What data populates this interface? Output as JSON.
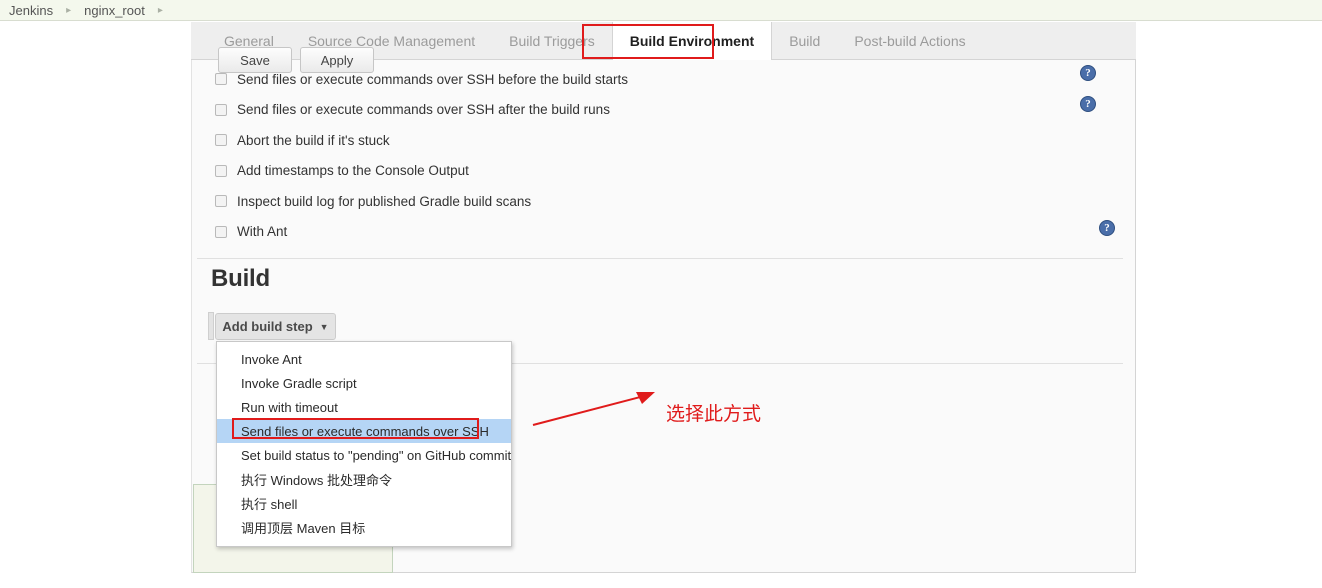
{
  "breadcrumb": {
    "items": [
      "Jenkins",
      "nginx_root"
    ],
    "separator": "▸"
  },
  "tabs": [
    {
      "label": "General",
      "selected": false
    },
    {
      "label": "Source Code Management",
      "selected": false
    },
    {
      "label": "Build Triggers",
      "selected": false
    },
    {
      "label": "Build Environment",
      "selected": true
    },
    {
      "label": "Build",
      "selected": false
    },
    {
      "label": "Post-build Actions",
      "selected": false
    }
  ],
  "build_environment": {
    "checkboxes": [
      {
        "label": "Send files or execute commands over SSH before the build starts",
        "checked": false,
        "help": true
      },
      {
        "label": "Send files or execute commands over SSH after the build runs",
        "checked": false,
        "help": true
      },
      {
        "label": "Abort the build if it's stuck",
        "checked": false,
        "help": false
      },
      {
        "label": "Add timestamps to the Console Output",
        "checked": false,
        "help": false
      },
      {
        "label": "Inspect build log for published Gradle build scans",
        "checked": false,
        "help": false
      },
      {
        "label": "With Ant",
        "checked": false,
        "help": true
      }
    ],
    "help_icon_glyph": "?"
  },
  "build_section": {
    "heading": "Build",
    "add_build_step": {
      "label": "Add build step",
      "caret": "▼"
    },
    "menu_items": [
      {
        "label": "Invoke Ant",
        "highlighted": false
      },
      {
        "label": "Invoke Gradle script",
        "highlighted": false
      },
      {
        "label": "Run with timeout",
        "highlighted": false
      },
      {
        "label": "Send files or execute commands over SSH",
        "highlighted": true
      },
      {
        "label": "Set build status to \"pending\" on GitHub commit",
        "highlighted": false
      },
      {
        "label": "执行 Windows 批处理命令",
        "highlighted": false
      },
      {
        "label": "执行 shell",
        "highlighted": false
      },
      {
        "label": "调用顶层 Maven 目标",
        "highlighted": false
      }
    ]
  },
  "bottom_bar": {
    "save_label": "Save",
    "apply_label": "Apply"
  },
  "annotations": {
    "note_text": "选择此方式",
    "color": "#e01b1b"
  }
}
